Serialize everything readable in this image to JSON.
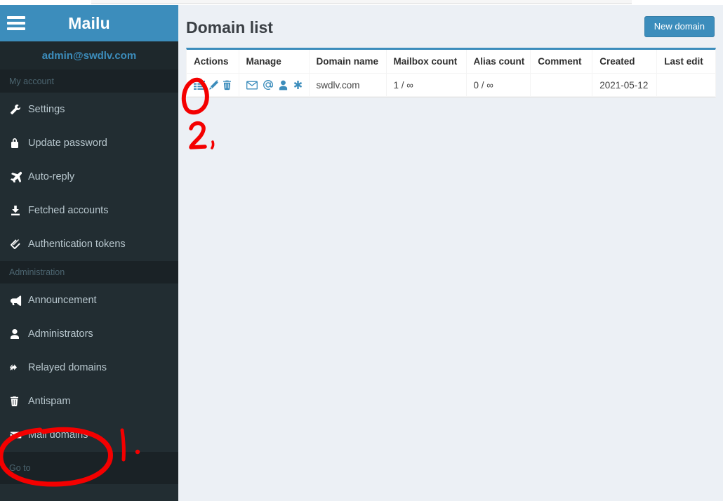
{
  "app": {
    "brand": "Mailu",
    "account_email": "admin@swdlv.com"
  },
  "sidebar": {
    "sections": [
      {
        "label": "My account",
        "items": [
          {
            "label": "Settings",
            "icon": "wrench-icon"
          },
          {
            "label": "Update password",
            "icon": "lock-icon"
          },
          {
            "label": "Auto-reply",
            "icon": "plane-icon"
          },
          {
            "label": "Fetched accounts",
            "icon": "download-icon"
          },
          {
            "label": "Authentication tokens",
            "icon": "tags-icon"
          }
        ]
      },
      {
        "label": "Administration",
        "items": [
          {
            "label": "Announcement",
            "icon": "bullhorn-icon"
          },
          {
            "label": "Administrators",
            "icon": "user-icon"
          },
          {
            "label": "Relayed domains",
            "icon": "reply-all-icon"
          },
          {
            "label": "Antispam",
            "icon": "trash-icon"
          },
          {
            "label": "Mail domains",
            "icon": "envelope-icon"
          }
        ]
      }
    ],
    "footer_label": "Go to"
  },
  "main": {
    "title": "Domain list",
    "new_button": "New domain",
    "table": {
      "columns": [
        "Actions",
        "Manage",
        "Domain name",
        "Mailbox count",
        "Alias count",
        "Comment",
        "Created",
        "Last edit"
      ],
      "rows": [
        {
          "actions": [
            "list-icon",
            "pencil-icon",
            "trash-icon"
          ],
          "manage": [
            "envelope-icon",
            "at-icon",
            "user-icon",
            "asterisk-icon"
          ],
          "domain_name": "swdlv.com",
          "mailbox_count": "1 / ∞",
          "alias_count": "0 / ∞",
          "comment": "",
          "created": "2021-05-12",
          "last_edit": ""
        }
      ]
    }
  },
  "annotations": {
    "color": "#f40000",
    "step_one": "1 .",
    "step_two": "2 ,"
  },
  "colors": {
    "brand_blue": "#3c8dbc",
    "sidebar_bg": "#222d32",
    "sidebar_header_bg": "#1a2226",
    "content_bg": "#ecf0f5",
    "annotation_red": "#f40000"
  }
}
